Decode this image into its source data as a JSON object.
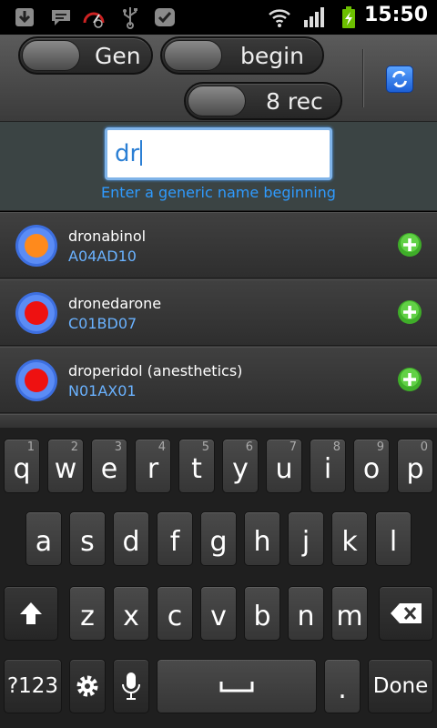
{
  "status_bar": {
    "time": "15:50",
    "icons": [
      "download-icon",
      "chat-icon",
      "speedometer-icon",
      "usb-icon",
      "check-icon",
      "wifi-icon",
      "signal-icon",
      "battery-charging-icon"
    ]
  },
  "filters": {
    "type_toggle_label": "Gen",
    "match_toggle_label": "begin",
    "count_toggle_label": "8 rec"
  },
  "search": {
    "value": "dr",
    "hint": "Enter a generic name beginning"
  },
  "results": [
    {
      "name": "dronabinol",
      "code": "A04AD10",
      "dot_color": "#ff8a1c"
    },
    {
      "name": "dronedarone",
      "code": "C01BD07",
      "dot_color": "#ee1111"
    },
    {
      "name": "droperidol (anesthetics)",
      "code": "N01AX01",
      "dot_color": "#ee1111"
    }
  ],
  "keyboard": {
    "row1": [
      {
        "label": "q",
        "num": "1"
      },
      {
        "label": "w",
        "num": "2"
      },
      {
        "label": "e",
        "num": "3"
      },
      {
        "label": "r",
        "num": "4"
      },
      {
        "label": "t",
        "num": "5"
      },
      {
        "label": "y",
        "num": "6"
      },
      {
        "label": "u",
        "num": "7"
      },
      {
        "label": "i",
        "num": "8"
      },
      {
        "label": "o",
        "num": "9"
      },
      {
        "label": "p",
        "num": "0"
      }
    ],
    "row2": [
      "a",
      "s",
      "d",
      "f",
      "g",
      "h",
      "j",
      "k",
      "l"
    ],
    "row3": [
      "z",
      "x",
      "c",
      "v",
      "b",
      "n",
      "m"
    ],
    "symbols_label": "?123",
    "period_label": ".",
    "done_label": "Done"
  },
  "colors": {
    "accent_blue": "#2f9bff",
    "code_blue": "#6ab2ff",
    "add_green": "#3fae29"
  }
}
